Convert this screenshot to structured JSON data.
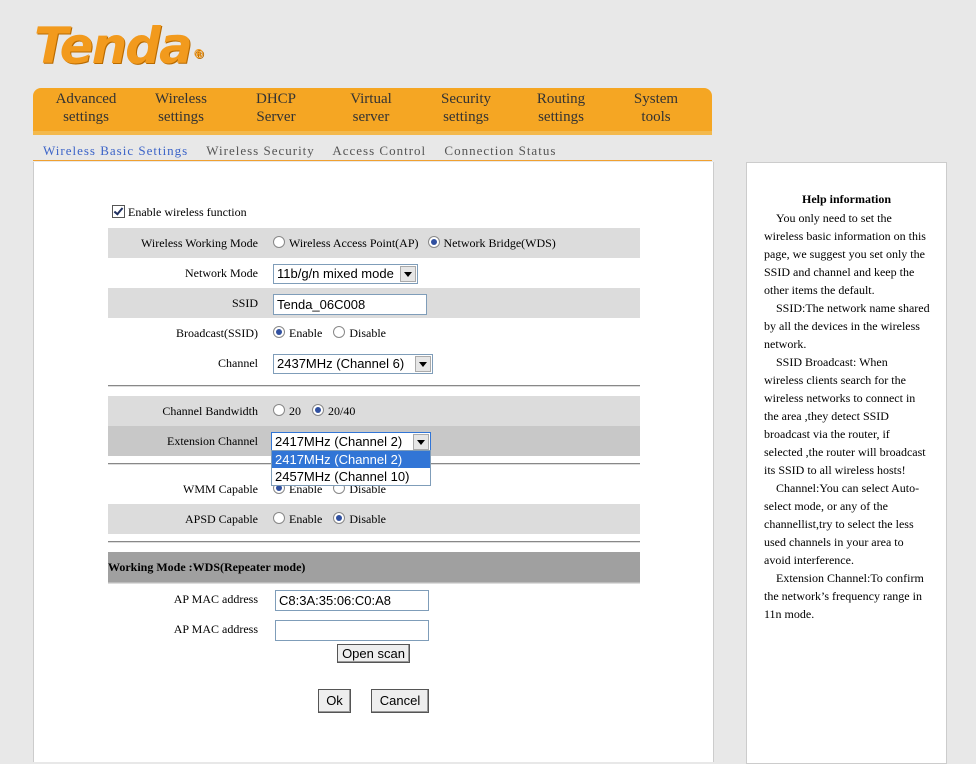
{
  "brand": {
    "name": "Tenda",
    "reg_mark": "®"
  },
  "nav": [
    {
      "line1": "Advanced",
      "line2": "settings"
    },
    {
      "line1": "Wireless",
      "line2": "settings"
    },
    {
      "line1": "DHCP",
      "line2": "Server"
    },
    {
      "line1": "Virtual",
      "line2": "server"
    },
    {
      "line1": "Security",
      "line2": "settings"
    },
    {
      "line1": "Routing",
      "line2": "settings"
    },
    {
      "line1": "System",
      "line2": "tools"
    }
  ],
  "subnav": [
    "Wireless Basic Settings",
    "Wireless Security",
    "Access Control",
    "Connection Status"
  ],
  "form": {
    "enable_label": "Enable wireless function",
    "mode_label": "Wireless Working Mode",
    "mode_ap": "Wireless Access Point(AP)",
    "mode_wds": "Network Bridge(WDS)",
    "netmode_label": "Network Mode",
    "netmode_value": "11b/g/n mixed mode",
    "ssid_label": "SSID",
    "ssid_value": "Tenda_06C008",
    "broadcast_label": "Broadcast(SSID)",
    "enable": "Enable",
    "disable": "Disable",
    "channel_label": "Channel",
    "channel_value": "2437MHz (Channel 6)",
    "bw_label": "Channel Bandwidth",
    "bw_20": "20",
    "bw_2040": "20/40",
    "ext_label": "Extension Channel",
    "ext_value": "2417MHz (Channel 2)",
    "ext_options": [
      "2417MHz (Channel 2)",
      "2457MHz (Channel 10)"
    ],
    "wmm_label": "WMM Capable",
    "apsd_label": "APSD Capable",
    "section_title": "Working Mode :WDS(Repeater mode)",
    "ap_mac_label": "AP MAC address",
    "ap_mac_1": "C8:3A:35:06:C0:A8",
    "ap_mac_2": "",
    "scan_button": "Open scan",
    "ok_button": "Ok",
    "cancel_button": "Cancel"
  },
  "help": {
    "title": "Help information",
    "paragraphs": [
      "You only need to set the wireless basic information on this page, we suggest you set only the SSID and channel and keep the other items the default.",
      "SSID:The network name shared by all the devices in the wireless network.",
      "SSID Broadcast: When wireless clients search for the wireless networks to connect in the area ,they detect SSID broadcast via the router, if selected ,the router will broadcast its SSID to all wireless hosts!",
      "Channel:You can select Auto-select mode, or any of the channellist,try to select the less used channels in your area to avoid interference.",
      "Extension Channel:To confirm the network’s frequency range in 11n mode."
    ]
  }
}
